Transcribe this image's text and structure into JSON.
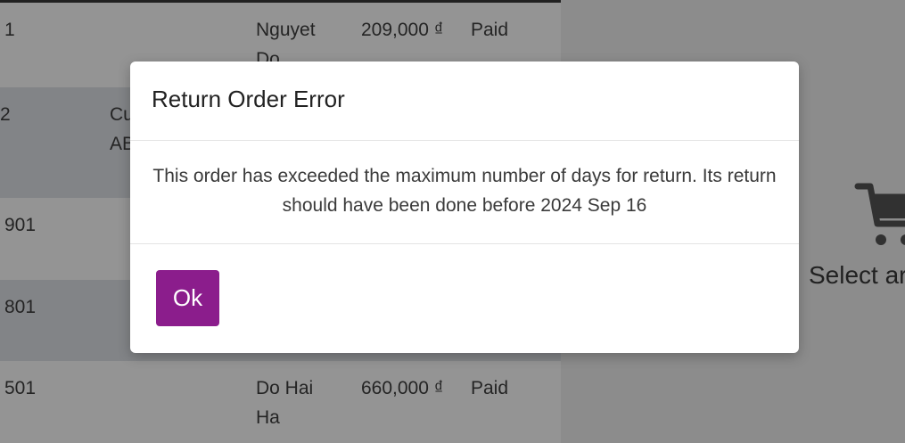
{
  "orders": [
    {
      "no": "1",
      "customer": "",
      "name": "Nguyet Do",
      "amount": "209,000 ₫",
      "status": "Paid"
    },
    {
      "no": "2",
      "customer": "Cu AB",
      "name": "",
      "amount": "",
      "status": ""
    },
    {
      "no": "901",
      "customer": "",
      "name": "",
      "amount": "",
      "status": ""
    },
    {
      "no": "801",
      "customer": "",
      "name": "",
      "amount": "",
      "status": ""
    },
    {
      "no": "501",
      "customer": "",
      "name": "Do Hai Ha",
      "amount": "660,000 ₫",
      "status": "Paid"
    }
  ],
  "right_panel": {
    "icon": "shopping-cart-icon",
    "text": "Select ar"
  },
  "dialog": {
    "title": "Return Order Error",
    "message": "This order has exceeded the maximum number of days for return. Its return should have been done before 2024 Sep 16",
    "ok_label": "Ok"
  },
  "colors": {
    "primary_button": "#8b1d8c",
    "row_alt": "#e1e3e8",
    "overlay": "rgba(0,0,0,0.42)"
  }
}
